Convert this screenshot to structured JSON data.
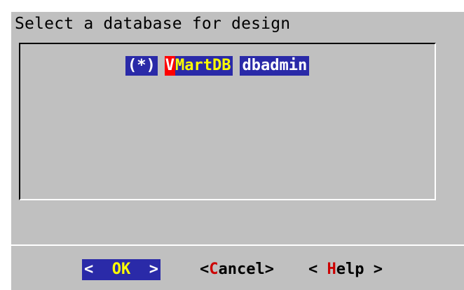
{
  "dialog": {
    "title": "Select a database for design"
  },
  "list": {
    "items": [
      {
        "radio": "(*)",
        "db_first": "V",
        "db_rest": "MartDB",
        "owner": "dbadmin"
      }
    ]
  },
  "buttons": {
    "ok": {
      "left": "<  ",
      "hot": "OK",
      "right": "  >"
    },
    "cancel": {
      "left": "<",
      "hot": "C",
      "rest": "ancel>"
    },
    "help": {
      "left": "< ",
      "hot": "H",
      "rest": "elp >"
    }
  },
  "colors": {
    "dialog_bg": "#c0c0c0",
    "highlight_bg": "#2a2aa8",
    "hotkey_yellow": "#ffff00",
    "hotkey_red": "#cc0000",
    "hot_bg_red": "#ff0000"
  }
}
